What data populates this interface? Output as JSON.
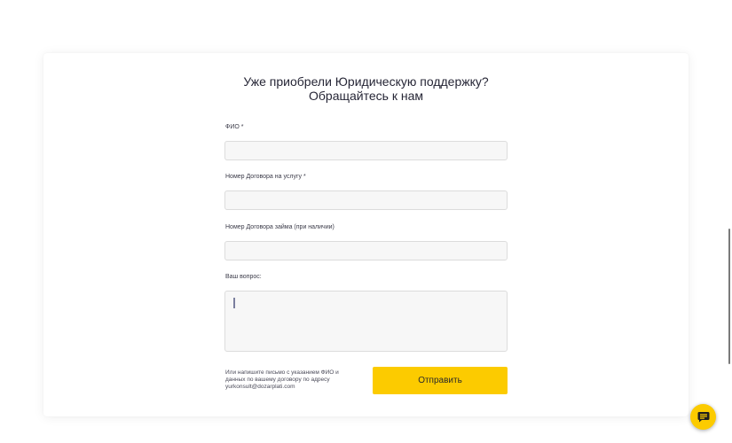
{
  "form": {
    "title_line1": "Уже приобрели Юридическую поддержку?",
    "title_line2": "Обращайтесь к нам",
    "fields": [
      {
        "label": "ФИО *",
        "value": ""
      },
      {
        "label": "Номер Договора на услугу *",
        "value": ""
      },
      {
        "label": "Номер Договора займа (при наличии)",
        "value": ""
      },
      {
        "label": "Ваш вопрос:",
        "value": ""
      }
    ],
    "note_line1": "Или напишите письмо с указанием ФИО и",
    "note_line2": "данных по вашему договору по адресу",
    "note_line3": "yurkonsult@dozarplati.com",
    "submit_label": "Отправить"
  },
  "chat": {
    "icon": "chat-icon"
  },
  "colors": {
    "accent": "#fccb00",
    "field_bg": "#f7f7f7",
    "field_border": "#dcdcdc"
  }
}
